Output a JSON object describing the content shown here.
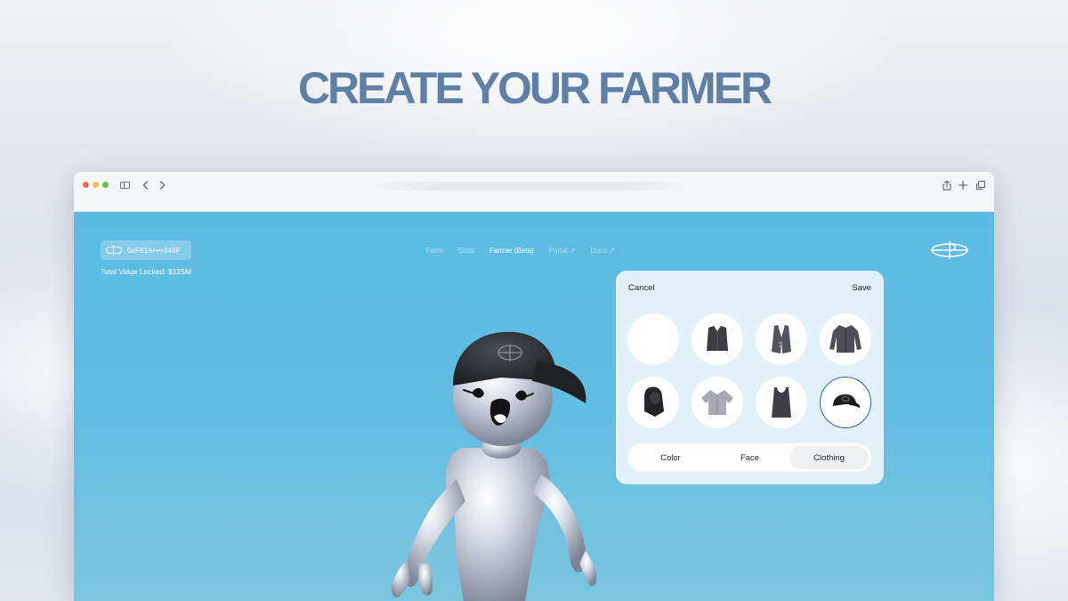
{
  "headline": "CREATE YOUR FARMER",
  "browser": {
    "toolbar": {
      "sidebar_icon": "sidebar-icon",
      "back_icon": "chevron-left-icon",
      "forward_icon": "chevron-right-icon",
      "share_icon": "share-icon",
      "new_tab_icon": "plus-icon",
      "tabs_icon": "tabs-icon"
    }
  },
  "app": {
    "wallet_address": "0xF81A••••246F",
    "tvl": "Total Value Locked: $125M",
    "nav": [
      "Farm",
      "Stats",
      "Farmer (Beta)",
      "Portal ↗",
      "Docs ↗"
    ],
    "nav_active": "Farmer (Beta)"
  },
  "editor": {
    "cancel": "Cancel",
    "save": "Save",
    "items": [
      {
        "name": "none",
        "icon": "empty-slot"
      },
      {
        "name": "vest",
        "icon": "vest-icon"
      },
      {
        "name": "waistcoat",
        "icon": "waistcoat-icon"
      },
      {
        "name": "jacket",
        "icon": "jacket-icon"
      },
      {
        "name": "hood",
        "icon": "hood-icon"
      },
      {
        "name": "shirt",
        "icon": "shirt-icon"
      },
      {
        "name": "tank-top",
        "icon": "tank-top-icon"
      },
      {
        "name": "cap",
        "icon": "cap-icon",
        "selected": true
      }
    ],
    "tabs": [
      "Color",
      "Face",
      "Clothing"
    ],
    "active_tab": "Clothing"
  },
  "colors": {
    "headline": "#5f7fa6",
    "page_bg": "#5dbbe3",
    "selected_ring": "#2c5fa8"
  }
}
